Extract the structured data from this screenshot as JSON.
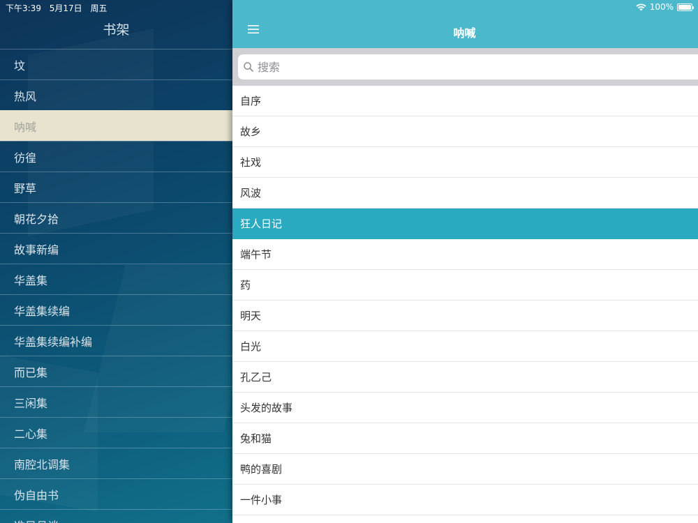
{
  "status_bar": {
    "time": "下午3:39",
    "date": "5月17日",
    "weekday": "周五",
    "battery": "100%",
    "battery_level": 1.0
  },
  "sidebar": {
    "title": "书架",
    "items": [
      {
        "label": "坟",
        "selected": false
      },
      {
        "label": "热风",
        "selected": false
      },
      {
        "label": "呐喊",
        "selected": true
      },
      {
        "label": "彷徨",
        "selected": false
      },
      {
        "label": "野草",
        "selected": false
      },
      {
        "label": "朝花夕拾",
        "selected": false
      },
      {
        "label": "故事新编",
        "selected": false
      },
      {
        "label": "华盖集",
        "selected": false
      },
      {
        "label": "华盖集续编",
        "selected": false
      },
      {
        "label": "华盖集续编补编",
        "selected": false
      },
      {
        "label": "而已集",
        "selected": false
      },
      {
        "label": "三闲集",
        "selected": false
      },
      {
        "label": "二心集",
        "selected": false
      },
      {
        "label": "南腔北调集",
        "selected": false
      },
      {
        "label": "伪自由书",
        "selected": false
      },
      {
        "label": "准风月谈",
        "selected": false
      }
    ]
  },
  "main": {
    "title": "呐喊",
    "menu_icon": "hamburger-menu-icon",
    "search": {
      "placeholder": "搜索",
      "value": ""
    },
    "chapters": [
      {
        "label": "自序",
        "selected": false
      },
      {
        "label": "故乡",
        "selected": false
      },
      {
        "label": "社戏",
        "selected": false
      },
      {
        "label": "风波",
        "selected": false
      },
      {
        "label": "狂人日记",
        "selected": true
      },
      {
        "label": "端午节",
        "selected": false
      },
      {
        "label": "药",
        "selected": false
      },
      {
        "label": "明天",
        "selected": false
      },
      {
        "label": "白光",
        "selected": false
      },
      {
        "label": "孔乙己",
        "selected": false
      },
      {
        "label": "头发的故事",
        "selected": false
      },
      {
        "label": "兔和猫",
        "selected": false
      },
      {
        "label": "鸭的喜剧",
        "selected": false
      },
      {
        "label": "一件小事",
        "selected": false
      }
    ]
  },
  "colors": {
    "accent": "#4bb8cc",
    "selected_row": "#2aaac0",
    "sidebar_selected": "#e7e3cf"
  }
}
